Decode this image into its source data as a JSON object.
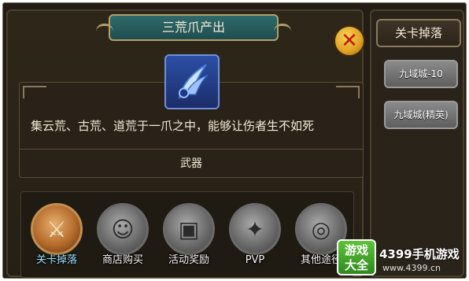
{
  "dialog": {
    "title": "三荒爪产出",
    "close_glyph": "✕",
    "item_icon": "claw-weapon-icon",
    "description": "集云荒、古荒、道荒于一爪之中，能够让伤者生不如死",
    "item_type": "武器"
  },
  "sources": [
    {
      "label": "关卡掉落",
      "icon": "crossed-swords-icon",
      "glyph": "⚔",
      "active": true
    },
    {
      "label": "商店购买",
      "icon": "merchant-icon",
      "glyph": "☺",
      "active": false
    },
    {
      "label": "活动奖励",
      "icon": "treasure-chest-icon",
      "glyph": "▣",
      "active": false
    },
    {
      "label": "PVP",
      "icon": "pvp-blade-icon",
      "glyph": "✦",
      "active": false
    },
    {
      "label": "其他途径",
      "icon": "other-source-icon",
      "glyph": "◎",
      "active": false
    }
  ],
  "side_panel": {
    "header": "关卡掉落",
    "stages": [
      "九域城-10",
      "九域城(精英)"
    ]
  },
  "watermark": {
    "badge_line1": "游戏",
    "badge_line2": "大全",
    "site_name": "4399手机游戏",
    "url": "www.4399.cn"
  },
  "colors": {
    "panel_bg": "#2e2719",
    "title_tab": "#2f6a6a",
    "close_button": "#e0a020",
    "active_label": "#9ce0ff"
  }
}
